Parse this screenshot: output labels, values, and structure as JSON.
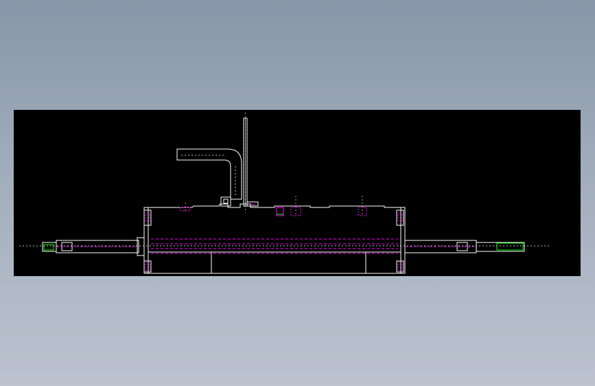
{
  "colors": {
    "background_top": "#8796a8",
    "background_bottom": "#bcc3cf",
    "canvas": "#000000",
    "outline": "#ffffff",
    "hidden_lines": "#ff00ff",
    "highlight": "#00ff00"
  },
  "drawing": {
    "view": "front elevation",
    "parts": [
      "housing",
      "shaft",
      "end-cap-left",
      "end-cap-right",
      "elbow-fitting",
      "vertical-bracket",
      "bolt-holes"
    ]
  }
}
